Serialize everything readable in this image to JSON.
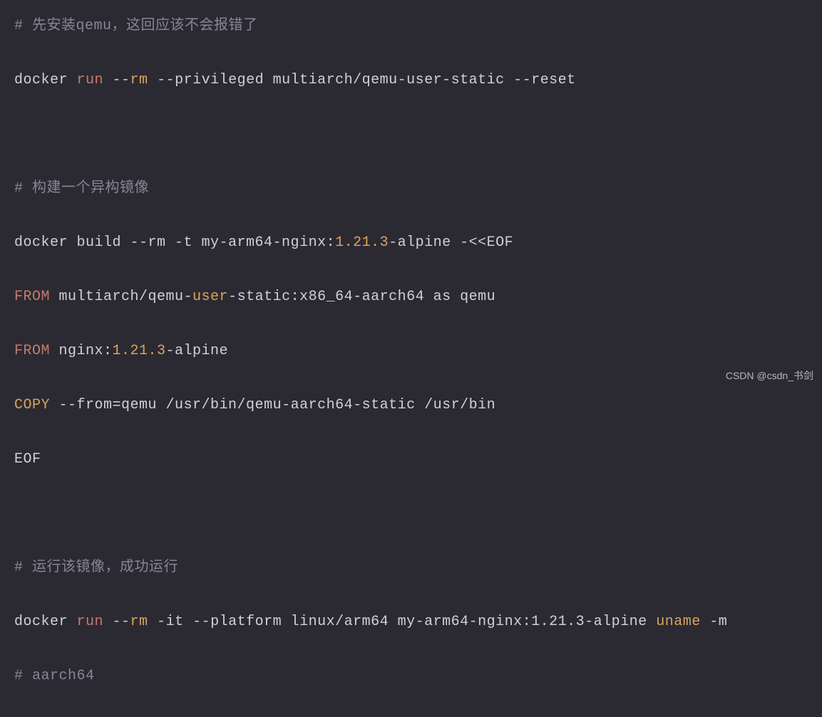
{
  "lines": {
    "l1_comment": "# 先安装qemu，这回应该不会报错了",
    "l2_docker": "docker ",
    "l2_run": "run",
    "l2_sp1": " --",
    "l2_rm": "rm",
    "l2_rest": " --privileged multiarch/qemu-user-static --reset",
    "l3_blank": " ",
    "l4_comment": "# 构建一个异构镜像",
    "l5_a": "docker build --rm -t my-arm64-nginx:",
    "l5_ver": "1.21.3",
    "l5_b": "-alpine -<<EOF",
    "l6_from": "FROM",
    "l6_a": " multiarch/qemu-",
    "l6_user": "user",
    "l6_b": "-static:x86_64-aarch64 as qemu",
    "l7_from": "FROM",
    "l7_a": " nginx:",
    "l7_ver": "1.21.3",
    "l7_b": "-alpine",
    "l8_copy": "COPY",
    "l8_rest": " --from=qemu /usr/bin/qemu-aarch64-static /usr/bin",
    "l9": "EOF",
    "l10_blank": " ",
    "l11_comment": "# 运行该镜像，成功运行",
    "l12_docker": "docker ",
    "l12_run": "run",
    "l12_sp1": " --",
    "l12_rm": "rm",
    "l12_mid": " -it --platform linux/arm64 my-arm64-nginx:1.21.3-alpine ",
    "l12_uname": "uname",
    "l12_end": " -m",
    "l13_comment": "# aarch64"
  },
  "watermark": "CSDN @csdn_书剑"
}
